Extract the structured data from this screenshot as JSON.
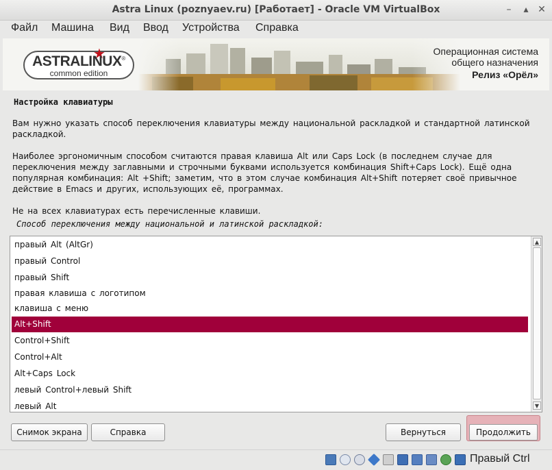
{
  "window": {
    "title": "Astra Linux (poznyaev.ru) [Работает] - Oracle VM VirtualBox"
  },
  "menu": [
    "Файл",
    "Машина",
    "Вид",
    "Ввод",
    "Устройства",
    "Справка"
  ],
  "banner": {
    "logo_main": "ASTRALINUX",
    "logo_registered": "®",
    "logo_sub": "common edition",
    "line1": "Операционная система",
    "line2": "общего назначения",
    "release": "Релиз «Орёл»"
  },
  "page": {
    "heading": "Настройка клавиатуры",
    "p1": "Вам нужно указать способ переключения клавиатуры между национальной раскладкой и стандартной латинской раскладкой.",
    "p2": "Наиболее эргономичным способом считаются правая клавиша Alt или Caps Lock (в последнем случае для переключения между заглавными и строчными буквами используется комбинация Shift+Caps Lock). Ещё одна популярная комбинация: Alt +Shift; заметим, что в этом случае комбинация Alt+Shift потеряет своё привычное действие в Emacs и других, использующих её, программах.",
    "p3": "Не на всех клавиатурах есть перечисленные клавиши.",
    "prompt": "Способ переключения между национальной и латинской раскладкой:"
  },
  "options": [
    "правый Alt (AltGr)",
    "правый Control",
    "правый Shift",
    "правая клавиша с логотипом",
    "клавиша с меню",
    "Alt+Shift",
    "Control+Shift",
    "Control+Alt",
    "Alt+Caps Lock",
    "левый Control+левый Shift",
    "левый Alt"
  ],
  "selected_option": "Alt+Shift",
  "buttons": {
    "screenshot": "Снимок экрана",
    "help": "Справка",
    "back": "Вернуться",
    "continue": "Продолжить"
  },
  "statusbar": {
    "host_key": "Правый Ctrl",
    "icons": [
      "hdd-icon",
      "optical-disk-icon",
      "audio-icon",
      "usb-icon",
      "shared-folder-icon",
      "display-icon",
      "network-icon",
      "recording-icon",
      "cpu-icon",
      "guest-additions-icon",
      "mouse-icon",
      "keyboard-icon"
    ]
  },
  "colors": {
    "selection": "#a0003a",
    "accent_button": "#e6b2b8",
    "logo_star": "#c0101a"
  }
}
